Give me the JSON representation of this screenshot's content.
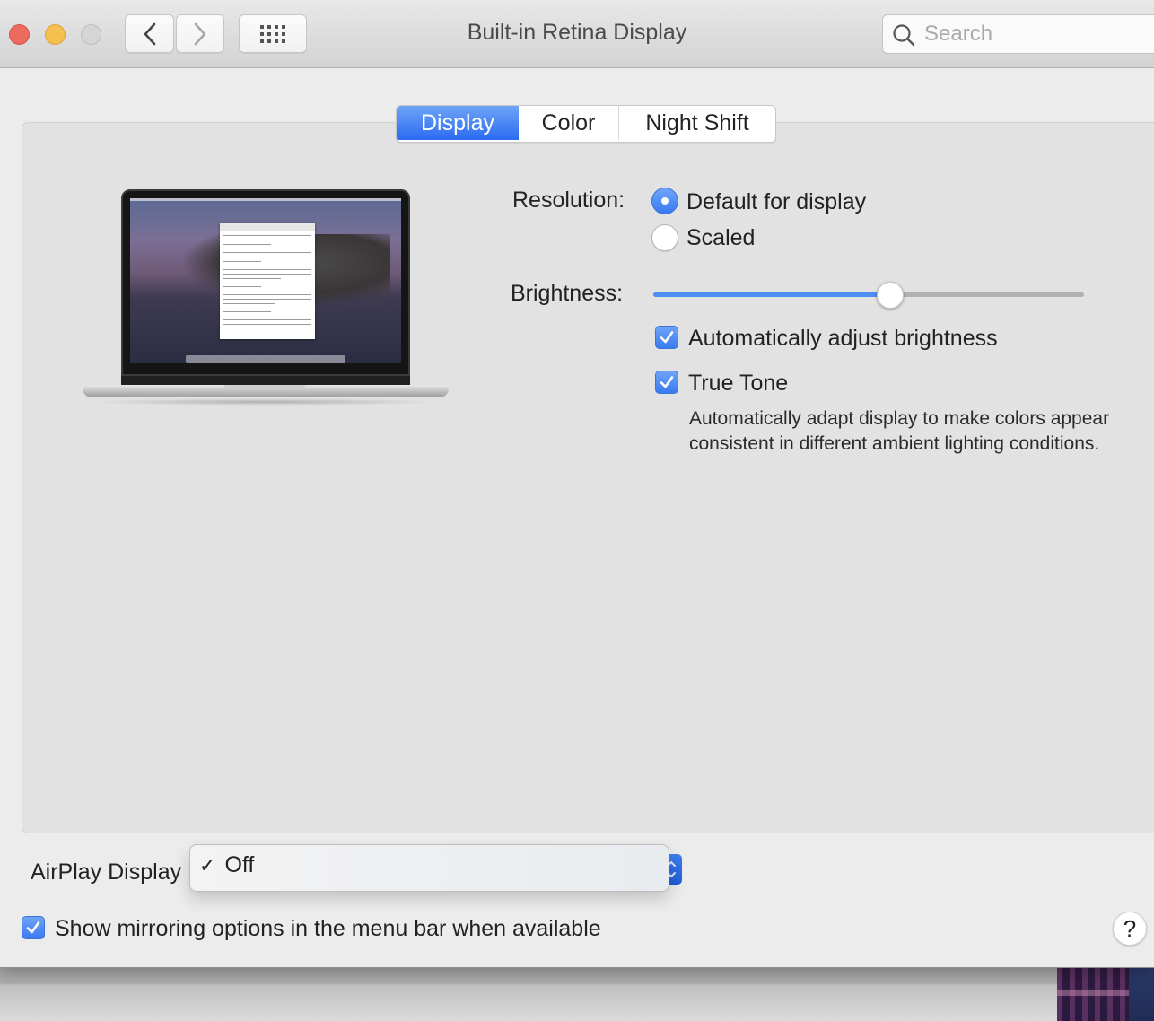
{
  "window": {
    "title": "Built-in Retina Display",
    "traffic_lights": [
      "close",
      "minimize",
      "zoom"
    ],
    "nav": {
      "back_icon": "chevron-left-icon",
      "forward_icon": "chevron-right-icon",
      "grid_icon": "show-all-grid-icon"
    },
    "search": {
      "placeholder": "Search",
      "value": "",
      "icon": "search-icon"
    }
  },
  "tabs": [
    {
      "label": "Display",
      "selected": true
    },
    {
      "label": "Color",
      "selected": false
    },
    {
      "label": "Night Shift",
      "selected": false
    }
  ],
  "display": {
    "preview_image": "MacBook Pro laptop with Catalina wallpaper",
    "resolution": {
      "label": "Resolution:",
      "options": [
        {
          "label": "Default for display",
          "selected": true
        },
        {
          "label": "Scaled",
          "selected": false
        }
      ]
    },
    "brightness": {
      "label": "Brightness:",
      "value_percent": 55
    },
    "auto_brightness": {
      "label": "Automatically adjust brightness",
      "checked": true
    },
    "true_tone": {
      "label": "True Tone",
      "checked": true,
      "description": "Automatically adapt display to make colors appear consistent in different ambient lighting conditions."
    }
  },
  "airplay": {
    "label": "AirPlay Display",
    "menu_open": true,
    "options": [
      {
        "label": "Off",
        "checked": true,
        "check_mark": "✓"
      }
    ]
  },
  "mirroring": {
    "label": "Show mirroring options in the menu bar when available",
    "checked": true
  },
  "help": {
    "label": "?"
  },
  "colors": {
    "accent": "#3b7bf2",
    "window_bg": "#ececec",
    "panel_bg": "#e2e2e2"
  }
}
